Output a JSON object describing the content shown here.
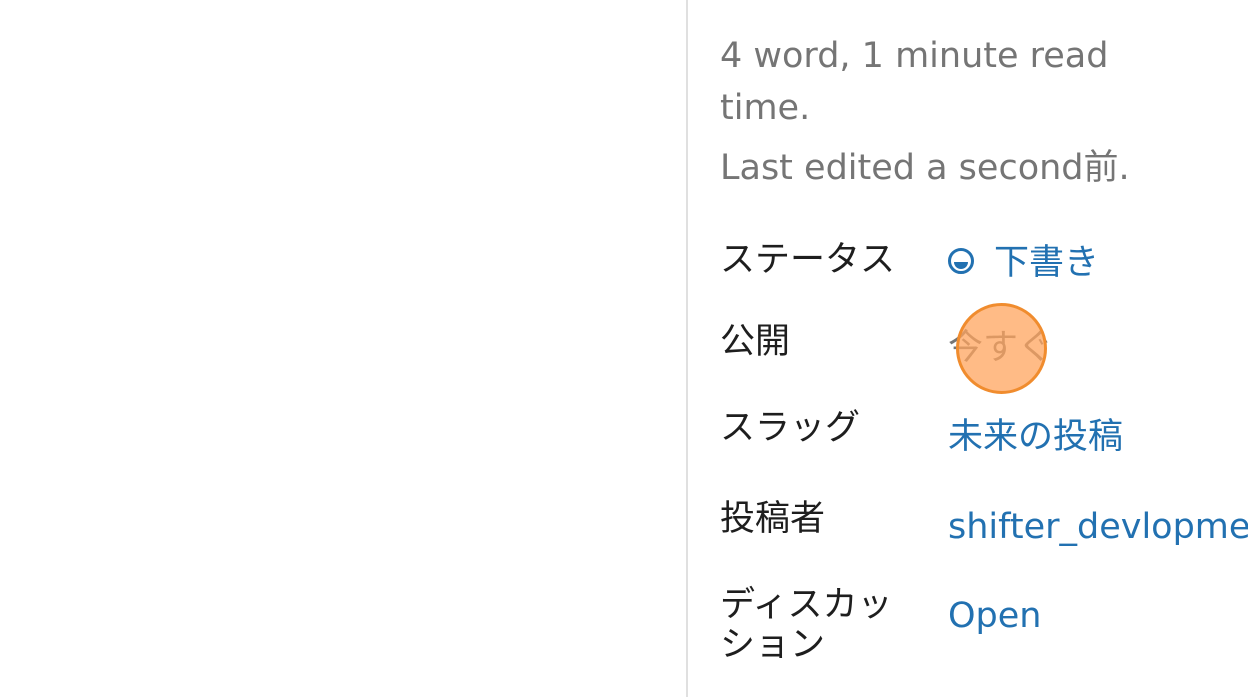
{
  "summary": {
    "stats": "4 word, 1 minute read time.",
    "last_edited": "Last edited a second前."
  },
  "rows": [
    {
      "label": "ステータス",
      "value": "下書き",
      "icon": "draft-circle-icon"
    },
    {
      "label": "公開",
      "value": "今すぐ"
    },
    {
      "label": "スラッグ",
      "value": "未来の投稿"
    },
    {
      "label": "投稿者",
      "value": "shifter_devlopment"
    },
    {
      "label": "ディスカッション",
      "value": "Open"
    }
  ],
  "colors": {
    "link": "#2271b1",
    "muted": "#757575",
    "text": "#1e1e1e",
    "click_marker": "#f08c2e"
  }
}
